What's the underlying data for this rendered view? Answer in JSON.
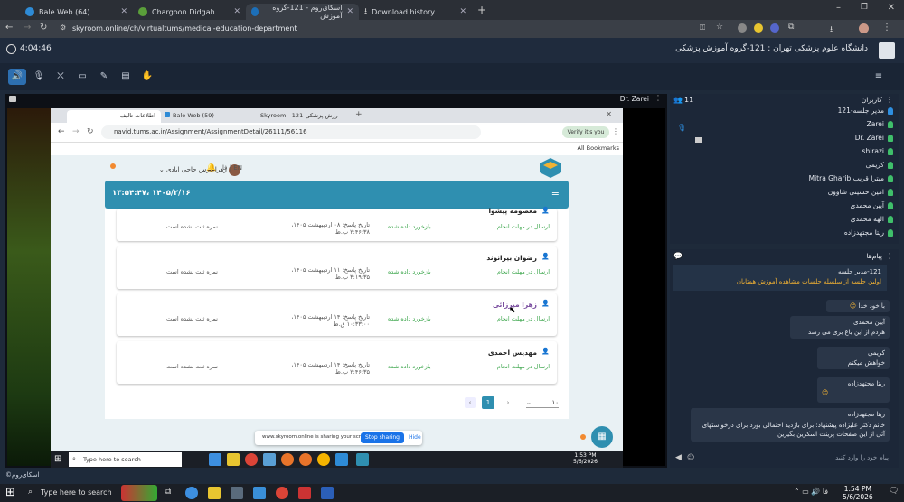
{
  "browser_tabs": [
    {
      "label": "Bale Web (64)",
      "color": "#2e8bd6"
    },
    {
      "label": "Chargoon Didgah",
      "color": "#5a9e3a"
    },
    {
      "label": "اسکای‌روم - 121-گروه آموزش",
      "color": "#1c6fb8"
    },
    {
      "label": "Download history",
      "color": "#888"
    }
  ],
  "url": "skyroom.online/ch/virtualtums/medical-education-department",
  "sky": {
    "timer": "4:04:46",
    "title": "دانشگاه علوم پزشکی تهران : 121-گروه آموزش پزشکی",
    "presenter": "Dr. Zarei",
    "users_count": "11",
    "users_title": "کاربران",
    "messages_title": "پیام‌ها",
    "chat_placeholder": "پیام خود را وارد کنید",
    "brand": "اسکای‌روم©"
  },
  "users": [
    "121-مدیر جلسه",
    "Zarei",
    "Dr. Zarei",
    "shirazi",
    "کریمی",
    "Mitra Gharib میترا قریب",
    "امین حسینی شاوون",
    "آیین محمدی",
    "الهه محمدی",
    "ریتا مجتهدزاده"
  ],
  "messages": [
    {
      "author": "121-مدیر جلسه",
      "text": "اولین جلسه از سلسله جلسات مشاهده آموزش همتایان"
    },
    {
      "author": "",
      "text": "با خود خدا"
    },
    {
      "author": "آیین محمدی",
      "text": "هردم از این باغ بری می رسد"
    },
    {
      "author": "کریمی",
      "text": "خواهش میکنم"
    },
    {
      "author": "ریتا مجتهدزاده",
      "text": ""
    },
    {
      "author": "ریتا مجتهدزاده",
      "text": "خانم دکتر علیزاده پیشنهاد: برای بازدید احتمالی بورد برای درخواستهای آتی از این صفحات پرینت اسکرین بگیرین"
    }
  ],
  "inner": {
    "tabs": [
      "اطلاعات تالیف",
      "Bale Web (59)",
      "Skyroom - 121-رزش پزشکی"
    ],
    "url": "navid.tums.ac.ir/Assignment/AssignmentDetail/26111/56116",
    "verify": "Verify it's you",
    "bookmarks": "All Bookmarks",
    "user_name": "زهرا پارس حاجی ابادی",
    "lang": "فا | EN",
    "datetime": "۱۴۰۵/۲/۱۶ ،۱۳:۵۴:۴۷",
    "page_current": "1",
    "page_size": "۱۰",
    "records": [
      {
        "name": "معصومه پیشوا",
        "status": "ارسال در مهلت انجام",
        "feedback": "بازخورد داده شده",
        "date": "تاریخ پاسخ: ۰۸ اردیبهشت ۱۴۰۵، ۲:۴۶:۳۸ ب.ظ",
        "grade": "نمره ثبت نشده است"
      },
      {
        "name": "رضوان بیرانوند",
        "status": "ارسال در مهلت انجام",
        "feedback": "بازخورد داده شده",
        "date": "تاریخ پاسخ: ۱۱ اردیبهشت ۱۴۰۵، ۳:۱۹:۳۵ ب.ظ",
        "grade": "نمره ثبت نشده است"
      },
      {
        "name": "زهرا میرزائی",
        "status": "ارسال در مهلت انجام",
        "feedback": "بازخورد داده شده",
        "date": "تاریخ پاسخ: ۱۴ اردیبهشت ۱۴۰۵، ۱۰:۳۳:۰۰ ق.ظ",
        "grade": "نمره ثبت نشده است"
      },
      {
        "name": "مهدیس احمدی",
        "status": "ارسال در مهلت انجام",
        "feedback": "بازخورد داده شده",
        "date": "تاریخ پاسخ: ۱۴ اردیبهشت ۱۴۰۵، ۲:۴۶:۳۵ ب.ظ",
        "grade": "نمره ثبت نشده است"
      }
    ],
    "share_text": "www.skyroom.online is sharing your screen.",
    "stop_sharing": "Stop sharing",
    "hide": "Hide",
    "search": "Type here to search",
    "time": "1:53 PM",
    "date": "5/6/2026"
  },
  "taskbar": {
    "search": "Type here to search",
    "time": "1:54 PM",
    "date": "5/6/2026"
  },
  "colors": {
    "accent": "#2e8fa8",
    "header": "#2f8fb0",
    "skybg": "#1e2a3a"
  }
}
